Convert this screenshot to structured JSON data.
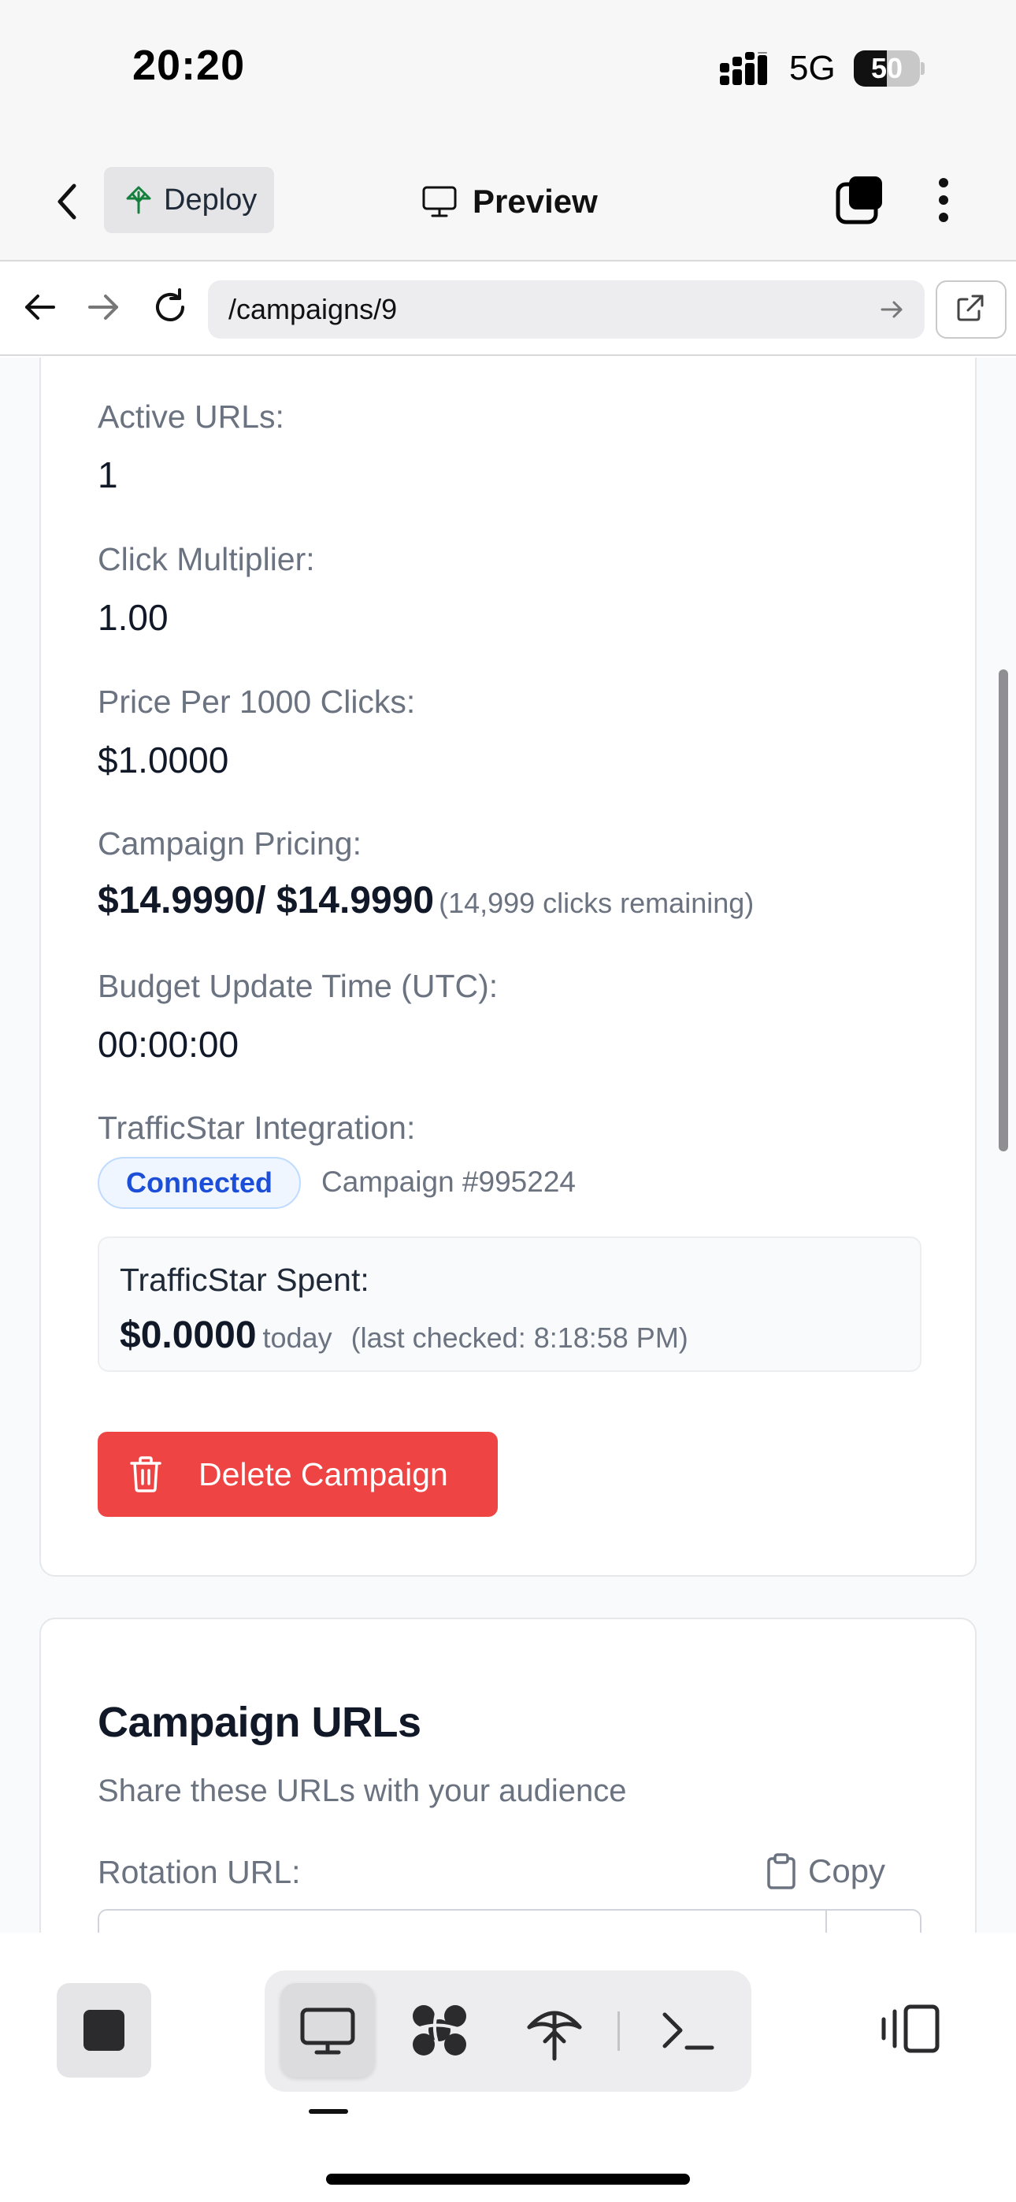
{
  "status_bar": {
    "time": "20:20",
    "network": "5G",
    "battery": "50",
    "battery_level": 0.5
  },
  "header": {
    "deploy_label": "Deploy",
    "preview_label": "Preview"
  },
  "url_bar": {
    "url": "/campaigns/9"
  },
  "campaign": {
    "active_urls_label": "Active URLs:",
    "active_urls_value": "1",
    "click_multiplier_label": "Click Multiplier:",
    "click_multiplier_value": "1.00",
    "price_label": "Price Per 1000 Clicks:",
    "price_value": "$1.0000",
    "pricing_label": "Campaign Pricing:",
    "pricing_value": "$14.9990/ $14.9990",
    "pricing_note": "(14,999 clicks remaining)",
    "budget_time_label": "Budget Update Time (UTC):",
    "budget_time_value": "00:00:00",
    "trafficstar_label": "TrafficStar Integration:",
    "trafficstar_status": "Connected",
    "trafficstar_campaign": "Campaign #995224",
    "spent_title": "TrafficStar Spent:",
    "spent_amount": "$0.0000",
    "spent_period": "today",
    "spent_checked": "(last checked: 8:18:58 PM)",
    "delete_label": "Delete Campaign"
  },
  "urls_section": {
    "title": "Campaign URLs",
    "subtitle": "Share these URLs with your audience",
    "rotation_label": "Rotation URL:",
    "copy_label": "Copy"
  },
  "icons": {
    "back": "chevron-left-icon",
    "deploy": "deploy-tree-icon",
    "preview": "monitor-icon",
    "tabs": "tabs-icon",
    "more": "more-vertical-icon",
    "nav_back": "arrow-left-icon",
    "nav_forward": "arrow-right-icon",
    "reload": "reload-icon",
    "go": "arrow-right-small-icon",
    "external": "external-link-icon",
    "delete": "trash-icon",
    "copy": "clipboard-icon",
    "stop": "stop-icon",
    "tool_preview": "monitor-icon",
    "tool_workflows": "knot-icon",
    "tool_deploy": "deploy-icon",
    "tool_shell": "terminal-icon",
    "panel": "panel-toggle-icon"
  },
  "colors": {
    "accent_danger": "#ef4444",
    "badge_blue": "#1d4ed8",
    "muted_text": "#6b7280"
  }
}
